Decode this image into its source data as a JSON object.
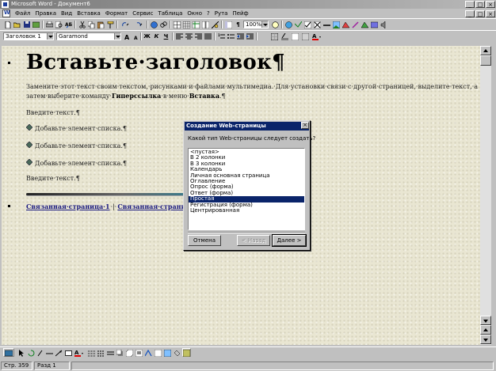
{
  "window": {
    "title": "Microsoft Word - Документ6",
    "min": "_",
    "max": "□",
    "close": "×"
  },
  "menu": {
    "items": [
      "Файл",
      "Правка",
      "Вид",
      "Вставка",
      "Формат",
      "Сервис",
      "Таблица",
      "Окно",
      "?",
      "Рута",
      "Пейф"
    ],
    "doc_min": "_",
    "doc_max": "□",
    "doc_close": "×"
  },
  "toolbar": {
    "zoom": "100%",
    "style": "Заголовок 1",
    "font": "Garamond",
    "bold": "Ж",
    "italic": "К",
    "underline": "Ч",
    "font_color": "#e00000"
  },
  "document": {
    "heading": "Вставьте·заголовок¶",
    "intro_line1": "Замените·этот·текст·своим·текстом,·рисунками·и·файлами·мультимедиа.·Для·установки·связи·с·другой·страницей,·выделите·текст,·а",
    "intro_line2_a": "затем·выберите·команду·",
    "intro_line2_b": "Гиперссылка",
    "intro_line2_c": "·в·меню·",
    "intro_line2_d": "Вставка",
    "intro_line2_e": ".¶",
    "enter_text_1": "Введите·текст.¶",
    "list_items": [
      "Добавьте·элемент·списка.¶",
      "Добавьте·элемент·списка.¶",
      "Добавьте·элемент·списка.¶"
    ],
    "enter_text_2": "Введите·текст.¶",
    "link1": "Связанная·страница·1",
    "link_sep": "·|·",
    "link2": "Связанная·страница·2",
    "link3_partial": "С"
  },
  "dialog": {
    "title": "Создание Web-страницы",
    "close": "×",
    "prompt": "Какой тип Web-страницы следует создать?",
    "options": [
      "<пустая>",
      "В 2 колонки",
      "В 3 колонки",
      "Календарь",
      "Личная основная страница",
      "Оглавление",
      "Опрос (форма)",
      "Ответ (форма)",
      "Простая",
      "Регистрация (форма)",
      "Центрированная"
    ],
    "selected": "Простая",
    "cancel": "Отмена",
    "back": "< Назад",
    "next": "Далее >"
  },
  "status": {
    "page": "Стр. 359",
    "section": "Разд 1"
  }
}
